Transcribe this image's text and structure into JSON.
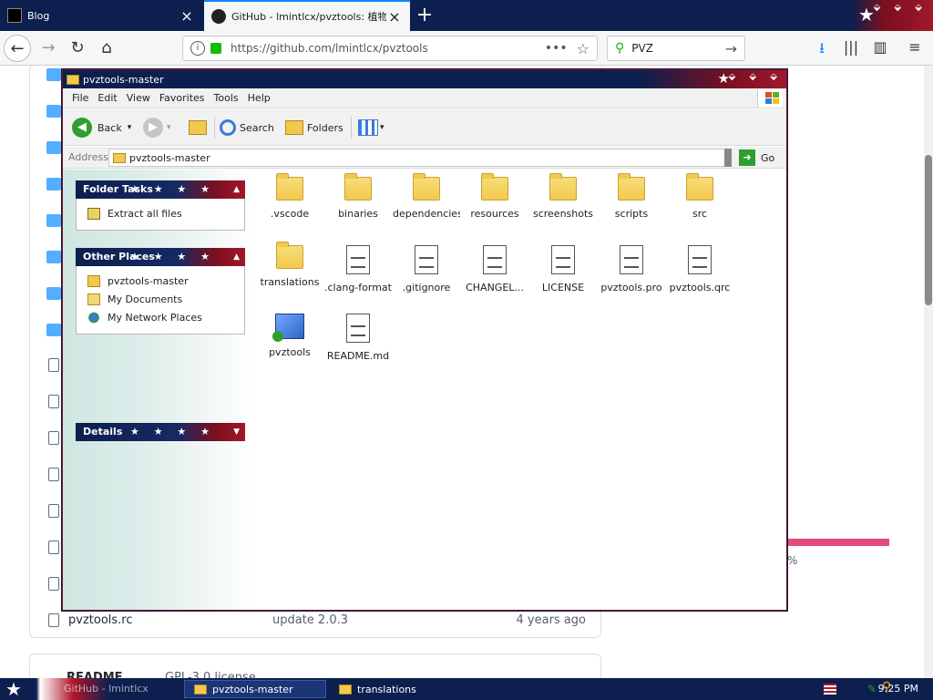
{
  "browser": {
    "tabs": [
      {
        "title": "Blog",
        "close": "×"
      },
      {
        "title": "GitHub - lmintlcx/pvztools: 植物大",
        "close": "×"
      }
    ],
    "new_tab": "+",
    "url": "https://github.com/lmintlcx/pvztools",
    "url_dots": "•••",
    "search_value": "PVZ",
    "nav": {
      "back": "←",
      "forward": "→",
      "reload": "↻",
      "home": "⌂"
    },
    "toolbar": {
      "download": "⭳",
      "library": "|||",
      "sidebar": "▥",
      "menu": "≡"
    },
    "window_controls": "⬙ ⬙ ⬙"
  },
  "github": {
    "last_file": {
      "name": "pvztools.rc",
      "commit": "update 2.0.3",
      "age": "4 years ago"
    },
    "readme_title": "README",
    "license": "GPL-3.0 license",
    "pct": "%"
  },
  "explorer": {
    "title": "pvztools-master",
    "menu": [
      "File",
      "Edit",
      "View",
      "Favorites",
      "Tools",
      "Help"
    ],
    "toolbar": {
      "back": "Back",
      "search": "Search",
      "folders": "Folders",
      "back_arrow": "◀",
      "fwd_arrow": "▶",
      "dropdown": "▾"
    },
    "address_label": "Address",
    "address_value": "pvztools-master",
    "go": "Go",
    "go_arrow": "➜",
    "taskpane": {
      "folder_tasks": {
        "title": "Folder Tasks",
        "items": [
          "Extract all files"
        ]
      },
      "other_places": {
        "title": "Other Places",
        "items": [
          "pvztools-master",
          "My Documents",
          "My Network Places"
        ]
      },
      "details": {
        "title": "Details"
      },
      "stars": "★ ★ ★ ★",
      "collapse": "▲",
      "expand": "▼"
    },
    "files": [
      {
        "name": ".vscode",
        "type": "folder"
      },
      {
        "name": "binaries",
        "type": "folder"
      },
      {
        "name": "dependencies",
        "type": "folder"
      },
      {
        "name": "resources",
        "type": "folder"
      },
      {
        "name": "screenshots",
        "type": "folder"
      },
      {
        "name": "scripts",
        "type": "folder"
      },
      {
        "name": "src",
        "type": "folder"
      },
      {
        "name": "translations",
        "type": "folder"
      },
      {
        "name": ".clang-format",
        "type": "file"
      },
      {
        "name": ".gitignore",
        "type": "file"
      },
      {
        "name": "CHANGEL...",
        "type": "file"
      },
      {
        "name": "LICENSE",
        "type": "file"
      },
      {
        "name": "pvztools.pro",
        "type": "file"
      },
      {
        "name": "pvztools.qrc",
        "type": "file"
      },
      {
        "name": "pvztools",
        "type": "app"
      },
      {
        "name": "README.md",
        "type": "file"
      }
    ]
  },
  "taskbar": {
    "start_glyph": "★",
    "start_overlay": "GitHub - lmintlcx",
    "tasks": [
      "pvztools-master",
      "translations"
    ],
    "time": "9:25 PM",
    "tray_icon1": "✎",
    "tray_icon2": "⚲"
  },
  "colors": {
    "theme_navy": "#0c1f4e",
    "theme_red": "#a0182a",
    "github_folder": "#54aeff",
    "lang_bar": "#e34c7a"
  }
}
